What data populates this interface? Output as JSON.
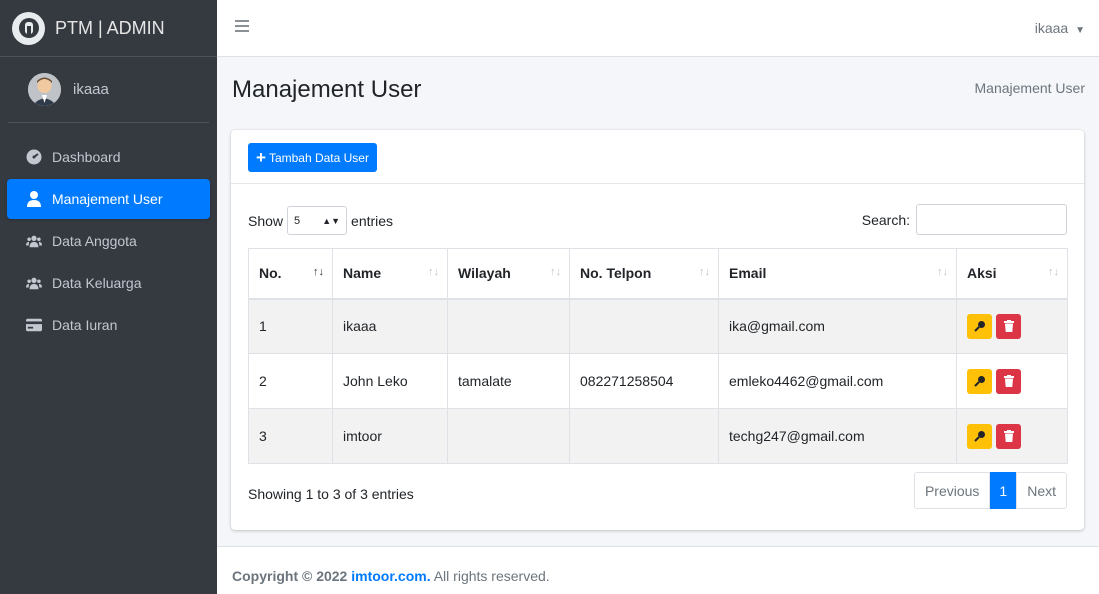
{
  "brand": {
    "text": "PTM | ADMIN"
  },
  "sidebar": {
    "user_name": "ikaaa",
    "items": [
      {
        "label": "Dashboard",
        "icon": "dashboard-icon"
      },
      {
        "label": "Manajement User",
        "icon": "user-icon",
        "active": true
      },
      {
        "label": "Data Anggota",
        "icon": "users-icon"
      },
      {
        "label": "Data Keluarga",
        "icon": "users-icon"
      },
      {
        "label": "Data Iuran",
        "icon": "card-icon"
      }
    ]
  },
  "topbar": {
    "user": "ikaaa"
  },
  "header": {
    "title": "Manajement User",
    "breadcrumb": "Manajement User"
  },
  "toolbar": {
    "add_label": "Tambah Data User"
  },
  "table_controls": {
    "show_label": "Show",
    "entries_label": "entries",
    "length_value": "5",
    "search_label": "Search:",
    "search_value": ""
  },
  "table": {
    "columns": [
      "No.",
      "Name",
      "Wilayah",
      "No. Telpon",
      "Email",
      "Aksi"
    ],
    "rows": [
      {
        "no": "1",
        "name": "ikaaa",
        "wilayah": "",
        "telpon": "",
        "email": "ika@gmail.com"
      },
      {
        "no": "2",
        "name": "John Leko",
        "wilayah": "tamalate",
        "telpon": "082271258504",
        "email": "emleko4462@gmail.com"
      },
      {
        "no": "3",
        "name": "imtoor",
        "wilayah": "",
        "telpon": "",
        "email": "techg247@gmail.com"
      }
    ]
  },
  "footer_info": "Showing 1 to 3 of 3 entries",
  "pagination": {
    "previous": "Previous",
    "current": "1",
    "next": "Next"
  },
  "footer": {
    "prefix": "Copyright © 2022",
    "link": "imtoor.com.",
    "suffix": "All rights reserved."
  },
  "colors": {
    "primary": "#007bff",
    "sidebar": "#343a40",
    "warning": "#ffc107",
    "danger": "#dc3545"
  }
}
